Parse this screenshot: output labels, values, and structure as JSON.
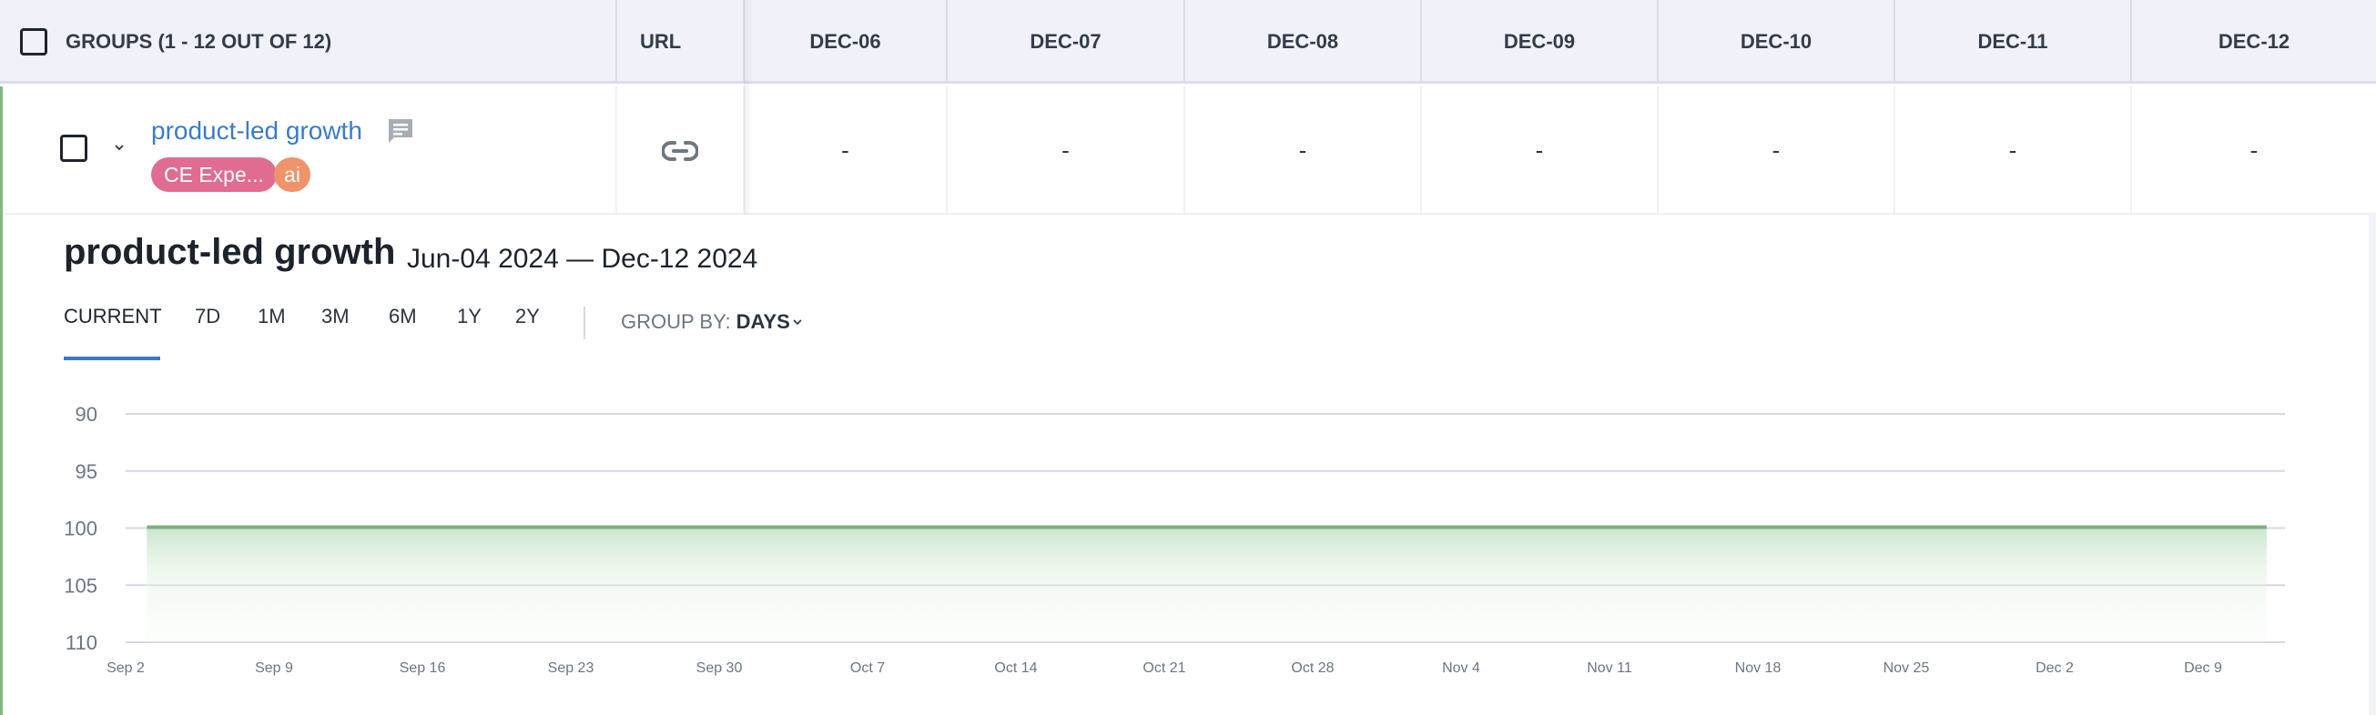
{
  "table": {
    "header": {
      "groups_label": "GROUPS (1 - 12 OUT OF 12)",
      "url_label": "URL",
      "date_columns": [
        "DEC-06",
        "DEC-07",
        "DEC-08",
        "DEC-09",
        "DEC-10",
        "DEC-11",
        "DEC-12"
      ]
    },
    "rows": [
      {
        "name": "product-led growth",
        "tags": [
          "CE Expe...",
          "ai"
        ],
        "values": [
          "-",
          "-",
          "-",
          "-",
          "-",
          "-",
          "-"
        ],
        "icons": {
          "comment": "comment-icon",
          "url": "link-icon",
          "expand": "chevron-down-icon"
        }
      }
    ]
  },
  "detail": {
    "title": "product-led growth",
    "date_range": "Jun-04 2024 — Dec-12 2024",
    "tabs": [
      {
        "label": "CURRENT",
        "active": true
      },
      {
        "label": "7D",
        "active": false
      },
      {
        "label": "1M",
        "active": false
      },
      {
        "label": "3M",
        "active": false
      },
      {
        "label": "6M",
        "active": false
      },
      {
        "label": "1Y",
        "active": false
      },
      {
        "label": "2Y",
        "active": false
      }
    ],
    "group_by_label": "GROUP BY:",
    "group_by_value": "DAYS"
  },
  "colors": {
    "accent": "#3b78cc",
    "link": "#3b7bc8",
    "tag_pink": "#e06c92",
    "tag_orange": "#ef936a",
    "series_green": "#7daf7c",
    "header_bg": "#f0f1f9"
  },
  "chart_data": {
    "type": "area",
    "title": "",
    "xlabel": "",
    "ylabel": "",
    "y_axis_inverted": true,
    "ylim": [
      90,
      110
    ],
    "y_ticks": [
      90,
      95,
      100,
      105,
      110
    ],
    "x_tick_labels": [
      "Sep 2",
      "Sep 9",
      "Sep 16",
      "Sep 23",
      "Sep 30",
      "Oct 7",
      "Oct 14",
      "Oct 21",
      "Oct 28",
      "Nov 4",
      "Nov 11",
      "Nov 18",
      "Nov 25",
      "Dec 2",
      "Dec 9"
    ],
    "x_range_days": [
      "Sep 2",
      "Dec 14"
    ],
    "grid": true,
    "series": [
      {
        "name": "product-led growth",
        "x_start": "Sep 3",
        "x_end": "Dec 12",
        "values_constant": 100
      }
    ]
  }
}
